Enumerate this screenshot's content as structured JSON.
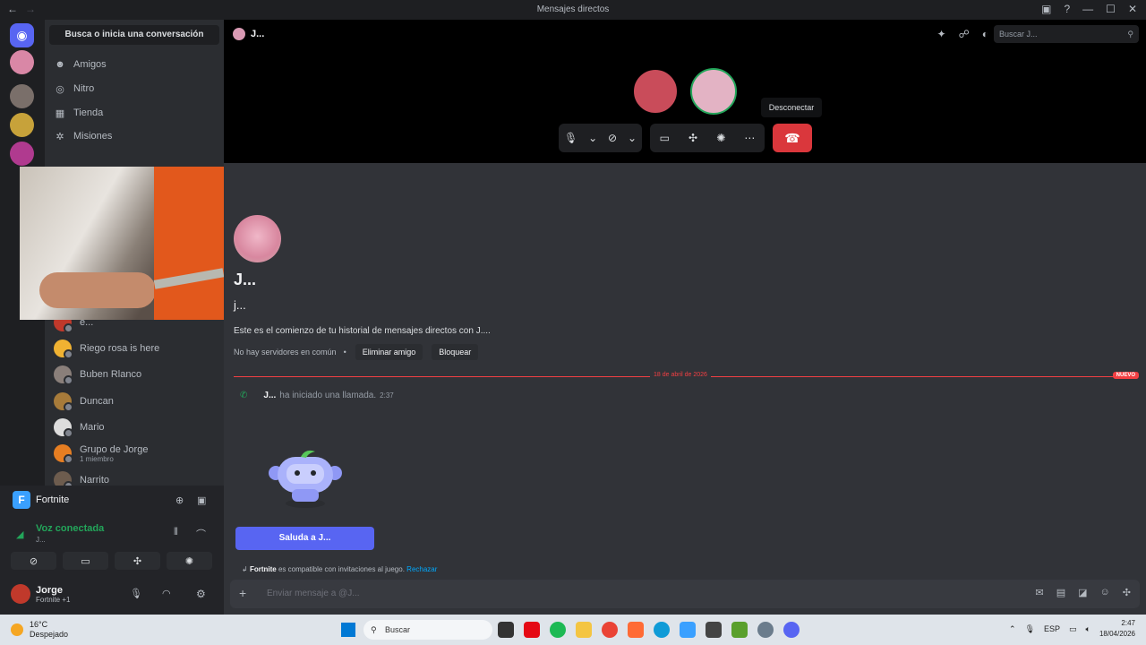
{
  "titlebar": {
    "title": "Mensajes directos"
  },
  "sidebar": {
    "search": "Busca o inicia una conversación",
    "nav": [
      {
        "label": "Amigos",
        "icon": "friends-icon"
      },
      {
        "label": "Nitro",
        "icon": "nitro-icon"
      },
      {
        "label": "Tienda",
        "icon": "shop-icon"
      },
      {
        "label": "Misiones",
        "icon": "quests-icon"
      }
    ],
    "dms": [
      {
        "name": "e..."
      },
      {
        "name": "Riego rosa is here"
      },
      {
        "name": "Buben Rlanco"
      },
      {
        "name": "Duncan"
      },
      {
        "name": "Mario"
      },
      {
        "name": "Grupo de Jorge",
        "sub": "1 miembro"
      },
      {
        "name": "Narrito"
      }
    ]
  },
  "voice": {
    "game": "Fortnite",
    "connected": "Voz conectada",
    "connected_sub": "J..."
  },
  "user": {
    "name": "Jorge",
    "status": "Fortnite +1"
  },
  "header": {
    "name": "J...",
    "search_placeholder": "Buscar J..."
  },
  "call": {
    "tooltip": "Desconectar"
  },
  "dm": {
    "display_name": "J...",
    "username": "j...",
    "intro": "Este es el comienzo de tu historial de mensajes directos con J....",
    "no_servers": "No hay servidores en común",
    "remove_friend": "Eliminar amigo",
    "block": "Bloquear",
    "date": "18 de abril de 2026",
    "new_badge": "NUEVO",
    "call_author": "J...",
    "call_text": "ha iniciado una llamada.",
    "call_time": "2:37",
    "wave_button": "Saluda a J...",
    "compat_game": "Fortnite",
    "compat_text": "es compatible con invitaciones al juego.",
    "compat_reject": "Rechazar",
    "composer_placeholder": "Enviar mensaje a @J..."
  },
  "taskbar": {
    "temp": "16°C",
    "weather": "Despejado",
    "search": "Buscar",
    "lang": "ESP",
    "time": "2:47",
    "date": "18/04/2026"
  },
  "colors": {
    "accent": "#5865f2",
    "danger": "#da373c",
    "online": "#23a55a"
  }
}
